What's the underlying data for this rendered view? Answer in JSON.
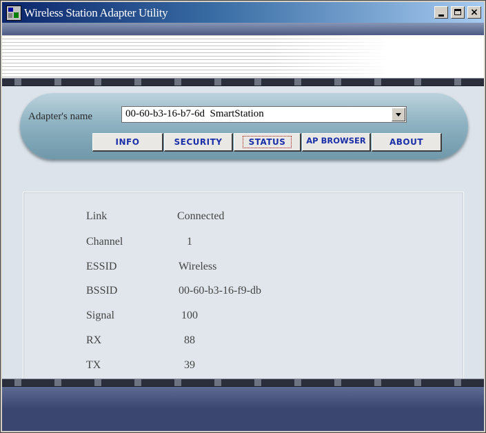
{
  "window": {
    "title": "Wireless Station Adapter Utility",
    "app_icon": "network-app-icon",
    "controls": {
      "minimize": "minimize-icon",
      "maximize": "maximize-icon",
      "close": "×"
    }
  },
  "adapter": {
    "label": "Adapter's name",
    "selected": "00-60-b3-16-b7-6d  SmartStation"
  },
  "tabs": [
    {
      "label": "INFO"
    },
    {
      "label": "SECURITY"
    },
    {
      "label": "STATUS",
      "selected": true
    },
    {
      "label": "AP BROWSER"
    },
    {
      "label": "ABOUT"
    }
  ],
  "status": [
    {
      "label": "Link",
      "value": "Connected"
    },
    {
      "label": "Channel",
      "value": "1"
    },
    {
      "label": "ESSID",
      "value": "Wireless"
    },
    {
      "label": "BSSID",
      "value": "00-60-b3-16-f9-db"
    },
    {
      "label": "Signal",
      "value": "100"
    },
    {
      "label": "RX",
      "value": "88"
    },
    {
      "label": "TX",
      "value": "39"
    }
  ],
  "colors": {
    "tab_text": "#1b2fa8",
    "title_bar": "#0a246a",
    "pill": "#8fb3c2"
  }
}
